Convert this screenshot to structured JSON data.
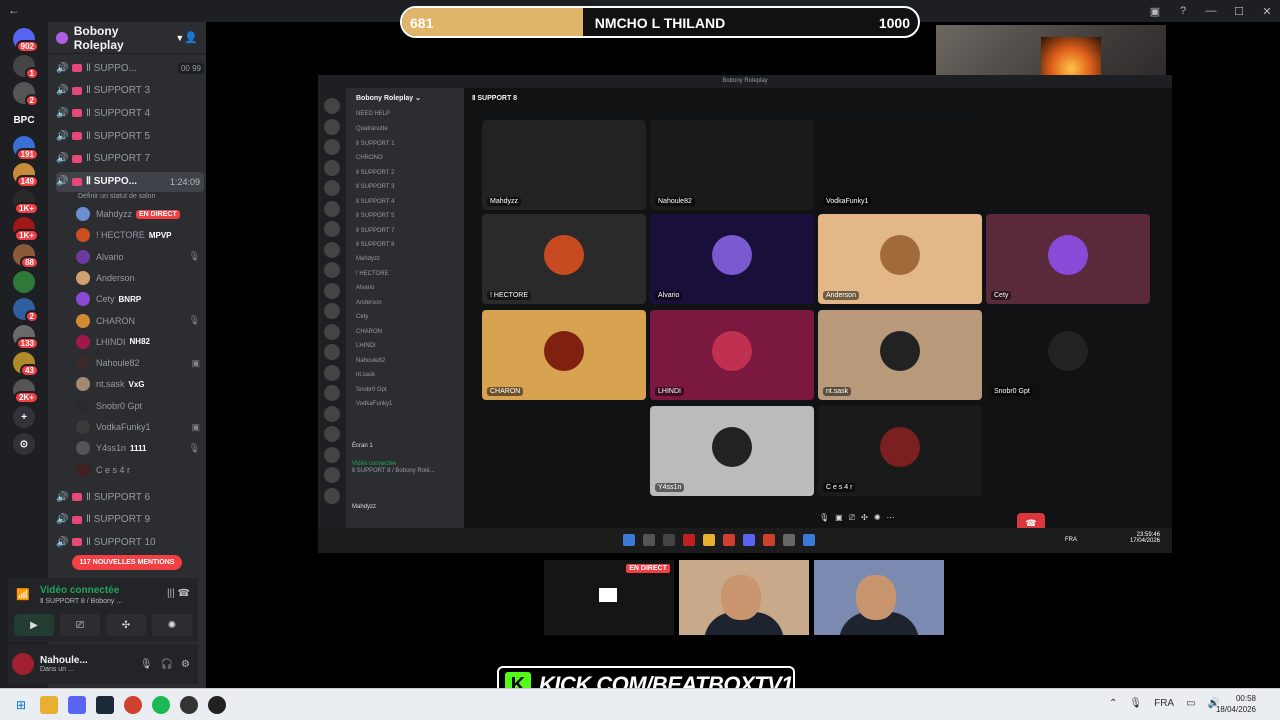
{
  "window": {
    "back": "←",
    "controls": [
      "▣",
      "?",
      "—",
      "☐",
      "✕"
    ]
  },
  "rail": {
    "items": [
      {
        "label": "",
        "badge": "902",
        "color": "#5865f2"
      },
      {
        "label": "",
        "badge": "1",
        "color": "#444444"
      },
      {
        "label": "",
        "badge": "2",
        "color": "#555555"
      },
      {
        "label": "BPC",
        "badge": "",
        "color": "#1e1f22"
      },
      {
        "label": "",
        "badge": "191",
        "color": "#3a6fd8"
      },
      {
        "label": "",
        "badge": "149",
        "color": "#c78c3a"
      },
      {
        "label": "",
        "badge": "1K+",
        "color": "#2a2a2a"
      },
      {
        "label": "",
        "badge": "1K+",
        "color": "#a01818"
      },
      {
        "label": "",
        "badge": "88",
        "color": "#8a5a3a"
      },
      {
        "label": "",
        "badge": "",
        "color": "#2f7a3a"
      },
      {
        "label": "",
        "badge": "2",
        "color": "#2f5fa0"
      },
      {
        "label": "",
        "badge": "133",
        "color": "#6a6a6a"
      },
      {
        "label": "",
        "badge": "43",
        "color": "#b08a2a"
      },
      {
        "label": "",
        "badge": "2K+",
        "color": "#555555"
      },
      {
        "label": "+",
        "badge": "",
        "color": "#313338"
      },
      {
        "label": "⊙",
        "badge": "",
        "color": "#313338"
      }
    ]
  },
  "server": {
    "name": "Bobony Roleplay"
  },
  "channels": [
    {
      "name": "Ⅱ SUPPO...",
      "limit": "00 99",
      "active": false
    },
    {
      "name": "Ⅱ SUPPORT 3",
      "limit": "",
      "active": false
    },
    {
      "name": "Ⅱ SUPPORT 4",
      "limit": "",
      "active": false
    },
    {
      "name": "Ⅱ SUPPORT 5",
      "limit": "",
      "active": false
    },
    {
      "name": "Ⅱ SUPPORT 7",
      "limit": "",
      "active": false
    },
    {
      "name": "Ⅱ SUPPO...",
      "time": "1:24:09",
      "active": true
    }
  ],
  "status_hint": "Définir un statut de salon",
  "users": [
    {
      "name": "Mahdyzz",
      "live": "EN DIRECT",
      "tag": "",
      "icon": "",
      "color": "#6b8fd0"
    },
    {
      "name": "! HECTORE",
      "live": "",
      "tag": "MPVP",
      "icon": "",
      "color": "#c85020"
    },
    {
      "name": "Alvario",
      "live": "",
      "tag": "",
      "icon": "🎙",
      "color": "#6a3aa0"
    },
    {
      "name": "Anderson",
      "live": "",
      "tag": "",
      "icon": "",
      "color": "#d0a070"
    },
    {
      "name": "Cety",
      "live": "",
      "tag": "BNRP",
      "icon": "",
      "color": "#8a4ad0"
    },
    {
      "name": "CHARON",
      "live": "",
      "tag": "",
      "icon": "🎙",
      "color": "#d08a30"
    },
    {
      "name": "LHINDI",
      "live": "",
      "tag": "NH82",
      "icon": "",
      "color": "#a01848"
    },
    {
      "name": "Nahoule82",
      "live": "",
      "tag": "",
      "icon": "▣",
      "color": "#3a2a2a"
    },
    {
      "name": "nt.sask",
      "live": "",
      "tag": "VxG",
      "icon": "",
      "color": "#a08a70"
    },
    {
      "name": "Snobr0 Gpt",
      "live": "",
      "tag": "",
      "icon": "",
      "color": "#2a2a2a"
    },
    {
      "name": "VodkaFunky1",
      "live": "",
      "tag": "",
      "icon": "▣",
      "color": "#3a3a3a"
    },
    {
      "name": "Y4ss1n",
      "live": "",
      "tag": "1111",
      "icon": "🎙",
      "color": "#555555"
    },
    {
      "name": "C e s 4 r",
      "live": "",
      "tag": "",
      "icon": "",
      "color": "#402020"
    }
  ],
  "channels_after": [
    {
      "name": "Ⅱ SUPPORT 6"
    },
    {
      "name": "Ⅱ SUPPORT 9"
    },
    {
      "name": "Ⅱ SUPPORT 10"
    }
  ],
  "mentions": "117 NOUVELLES MENTIONS",
  "voice": {
    "title": "Vidéo connectée",
    "sub": "Ⅱ SUPPORT 8 / Bobony ..."
  },
  "self": {
    "name": "Nahoule...",
    "status": "Dans un ..."
  },
  "score": {
    "left": "681",
    "right": "1000",
    "title": "NMCHO L THILAND",
    "progress": 0.681
  },
  "inner": {
    "window_title": "Bobony Roleplay",
    "server": "Bobony Roleplay ⌄",
    "channel": "Ⅱ SUPPORT 8",
    "side_rows": [
      "NEED HELP",
      "Quatranutte",
      "Ⅱ SUPPORT 1",
      "CHRONO",
      "Ⅱ SUPPORT 2",
      "Ⅱ SUPPORT 3",
      "Ⅱ SUPPORT 4",
      "Ⅱ SUPPORT 5",
      "Ⅱ SUPPORT 7",
      "Ⅱ SUPPORT 8",
      "Mahdyzz",
      "! HECTORE",
      "Alvario",
      "Anderson",
      "Cety",
      "CHARON",
      "LHINDI",
      "Nahoule82",
      "nt.sask",
      "Snobr0 Gpt",
      "VodkaFunky1"
    ],
    "screen_label": "Écran 1",
    "voice": "Vidéo connectée",
    "voice_sub": "Ⅱ SUPPORT 8 / Bobony Rolé...",
    "self": "Mahdyzz",
    "tiles": [
      {
        "label": "Mahdyzz",
        "bg": "#222",
        "pic": ""
      },
      {
        "label": "Nahoule82",
        "bg": "#1a1a1a",
        "pic": ""
      },
      {
        "label": "VodkaFunky1",
        "bg": "#111",
        "pic": ""
      },
      {
        "label": "! HECTORE",
        "bg": "#2a2a2a",
        "pic": "#c84a20"
      },
      {
        "label": "Alvario",
        "bg": "#1a0f3a",
        "pic": "#7a5ad0"
      },
      {
        "label": "Anderson",
        "bg": "#e2b889",
        "pic": "#a06a3a"
      },
      {
        "label": "Cety",
        "bg": "#5a2a3a",
        "pic": "#8a4ad8"
      },
      {
        "label": "CHARON",
        "bg": "#d8a350",
        "pic": "#802010"
      },
      {
        "label": "LHINDI",
        "bg": "#7a1840",
        "pic": "#c03050"
      },
      {
        "label": "nt.sask",
        "bg": "#b89a7a",
        "pic": "#222"
      },
      {
        "label": "Snobr0 Gpt",
        "bg": "#111",
        "pic": "#222"
      },
      {
        "label": "Y4ss1n",
        "bg": "#bbbbbb",
        "pic": "#222"
      },
      {
        "label": "C e s 4 r",
        "bg": "#1a1a1a",
        "pic": "#7a2020"
      }
    ],
    "lang": "FRA",
    "clock_time": "23:59:46",
    "clock_date": "17/04/2026"
  },
  "cams": [
    {
      "live": "EN DIRECT"
    }
  ],
  "kick": {
    "letter": "K",
    "url": "KICK.COM/BEATBOXTV1"
  },
  "taskbar": {
    "lang": "FRA",
    "time": "00:58",
    "date": "18/04/2026"
  }
}
